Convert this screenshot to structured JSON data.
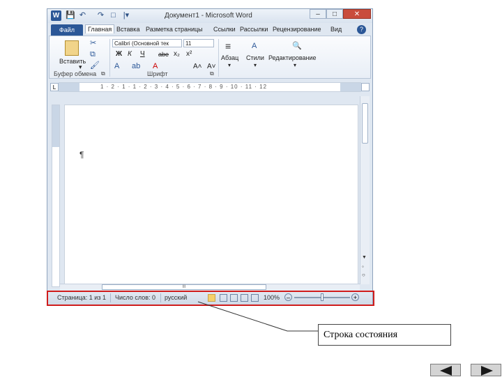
{
  "window": {
    "title": "Документ1 - Microsoft Word",
    "logo_letter": "W",
    "controls": {
      "minimize": "–",
      "maximize": "□",
      "close": "✕"
    },
    "help": "?"
  },
  "quick_access": {
    "save": "💾",
    "undo": "↶",
    "redo": "↷",
    "new": "□",
    "customize": "|▾"
  },
  "tabs": {
    "file": "Файл",
    "items": [
      "Главная",
      "Вставка",
      "Разметка страницы",
      "Ссылки",
      "Рассылки",
      "Рецензирование",
      "Вид"
    ]
  },
  "ribbon": {
    "clipboard": {
      "paste": "Вставить",
      "label": "Буфер обмена",
      "launcher": "⧉"
    },
    "font": {
      "name": "Calibri (Основной тек",
      "size": "11",
      "row2": [
        "Ж",
        "К",
        "Ч",
        "abe",
        "x₂",
        "x²"
      ],
      "grow": "A˄",
      "shrink": "A˅",
      "label": "Шрифт",
      "launcher": "⧉"
    },
    "paragraph": {
      "label": "Абзац"
    },
    "styles": {
      "label": "Стили"
    },
    "editing": {
      "label": "Редактирование"
    },
    "arrow": "▾"
  },
  "ruler": {
    "numbers": "1 · 2 · 1 · 1 · 2 · 3 · 4 · 5 · 6 · 7 · 8 · 9 · 10 · 11 · 12",
    "tab_selector": "L"
  },
  "document": {
    "pilcrow": "¶"
  },
  "scroll": {
    "up": "▲",
    "down": "▼",
    "prev": "◦",
    "select": "○",
    "hscroll_mark": "III"
  },
  "statusbar": {
    "page": "Страница: 1 из 1",
    "words": "Число слов: 0",
    "language": "русский",
    "zoom": "100%",
    "zoom_out": "–",
    "zoom_in": "+",
    "zoom_level": 0.5
  },
  "callout": {
    "text": "Строка состояния"
  },
  "nav": {
    "back": "◀",
    "forward": "▶"
  },
  "colors": {
    "highlight": "#d01c1c",
    "accent": "#2b5797"
  }
}
